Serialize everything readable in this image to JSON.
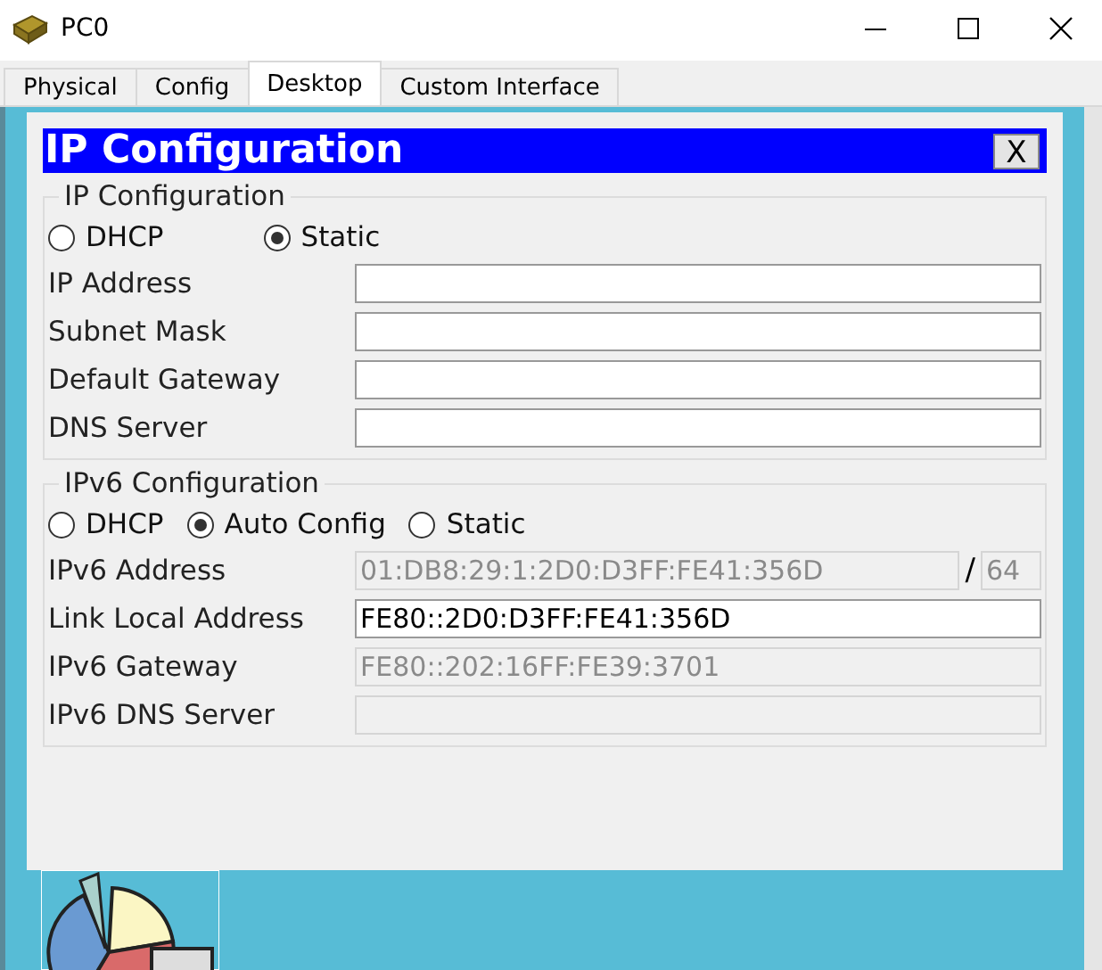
{
  "window": {
    "title": "PC0"
  },
  "tabs": [
    {
      "label": "Physical",
      "selected": false
    },
    {
      "label": "Config",
      "selected": false
    },
    {
      "label": "Desktop",
      "selected": true
    },
    {
      "label": "Custom Interface",
      "selected": false
    }
  ],
  "dialog": {
    "title": "IP Configuration",
    "close": "X",
    "ipv4": {
      "legend": "IP Configuration",
      "modes": [
        {
          "label": "DHCP",
          "selected": false
        },
        {
          "label": "Static",
          "selected": true
        }
      ],
      "fields": [
        {
          "label": "IP Address",
          "disabled": false
        },
        {
          "label": "Subnet Mask",
          "disabled": false
        },
        {
          "label": "Default Gateway",
          "disabled": false
        },
        {
          "label": "DNS Server",
          "disabled": false
        }
      ]
    },
    "ipv6": {
      "legend": "IPv6 Configuration",
      "modes": [
        {
          "label": "DHCP",
          "selected": false
        },
        {
          "label": "Auto Config",
          "selected": true
        },
        {
          "label": "Static",
          "selected": false
        }
      ],
      "fields": [
        {
          "label": "IPv6 Address",
          "value": "01:DB8:29:1:2D0:D3FF:FE41:356D",
          "disabled": true,
          "separator": "/",
          "prefix": "64"
        },
        {
          "label": "Link Local Address",
          "value": "FE80::2D0:D3FF:FE41:356D",
          "disabled": false
        },
        {
          "label": "IPv6 Gateway",
          "value": "FE80::202:16FF:FE39:3701",
          "disabled": true
        },
        {
          "label": "IPv6 DNS Server",
          "disabled": true
        }
      ]
    }
  }
}
